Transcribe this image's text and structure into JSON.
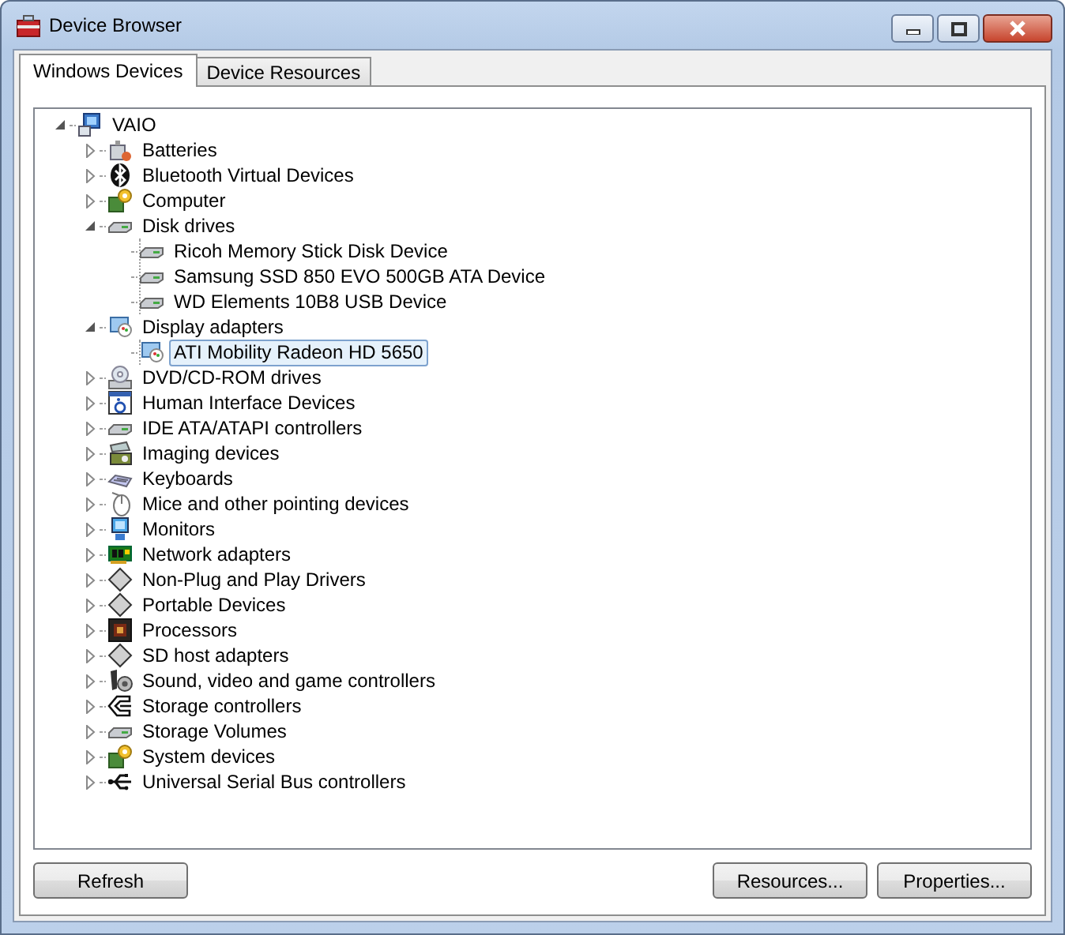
{
  "window": {
    "title": "Device Browser"
  },
  "tabs": [
    {
      "label": "Windows Devices",
      "selected": true
    },
    {
      "label": "Device Resources",
      "selected": false
    }
  ],
  "tree": [
    {
      "label": "VAIO",
      "kind": "computer",
      "expanded": true,
      "selected": false,
      "children": [
        {
          "label": "Batteries",
          "kind": "battery",
          "expanded": false,
          "selected": false
        },
        {
          "label": "Bluetooth Virtual Devices",
          "kind": "bluetooth",
          "expanded": false,
          "selected": false
        },
        {
          "label": "Computer",
          "kind": "system",
          "expanded": false,
          "selected": false
        },
        {
          "label": "Disk drives",
          "kind": "disk",
          "expanded": true,
          "selected": false,
          "children": [
            {
              "label": "Ricoh Memory Stick Disk Device",
              "kind": "disk",
              "selected": false
            },
            {
              "label": "Samsung SSD 850 EVO 500GB ATA Device",
              "kind": "disk",
              "selected": false
            },
            {
              "label": "WD Elements 10B8 USB Device",
              "kind": "disk",
              "selected": false
            }
          ]
        },
        {
          "label": "Display adapters",
          "kind": "display",
          "expanded": true,
          "selected": false,
          "children": [
            {
              "label": "ATI Mobility Radeon HD 5650",
              "kind": "display",
              "selected": true
            }
          ]
        },
        {
          "label": "DVD/CD-ROM drives",
          "kind": "dvd",
          "expanded": false,
          "selected": false
        },
        {
          "label": "Human Interface Devices",
          "kind": "hid",
          "expanded": false,
          "selected": false
        },
        {
          "label": "IDE ATA/ATAPI controllers",
          "kind": "disk",
          "expanded": false,
          "selected": false
        },
        {
          "label": "Imaging devices",
          "kind": "imaging",
          "expanded": false,
          "selected": false
        },
        {
          "label": "Keyboards",
          "kind": "keyboard",
          "expanded": false,
          "selected": false
        },
        {
          "label": "Mice and other pointing devices",
          "kind": "mouse",
          "expanded": false,
          "selected": false
        },
        {
          "label": "Monitors",
          "kind": "monitor",
          "expanded": false,
          "selected": false
        },
        {
          "label": "Network adapters",
          "kind": "network",
          "expanded": false,
          "selected": false
        },
        {
          "label": "Non-Plug and Play Drivers",
          "kind": "generic",
          "expanded": false,
          "selected": false
        },
        {
          "label": "Portable Devices",
          "kind": "generic",
          "expanded": false,
          "selected": false
        },
        {
          "label": "Processors",
          "kind": "processor",
          "expanded": false,
          "selected": false
        },
        {
          "label": "SD host adapters",
          "kind": "generic",
          "expanded": false,
          "selected": false
        },
        {
          "label": "Sound, video and game controllers",
          "kind": "sound",
          "expanded": false,
          "selected": false
        },
        {
          "label": "Storage controllers",
          "kind": "storage",
          "expanded": false,
          "selected": false
        },
        {
          "label": "Storage Volumes",
          "kind": "disk",
          "expanded": false,
          "selected": false
        },
        {
          "label": "System devices",
          "kind": "system",
          "expanded": false,
          "selected": false
        },
        {
          "label": "Universal Serial Bus controllers",
          "kind": "usb",
          "expanded": false,
          "selected": false
        }
      ]
    }
  ],
  "buttons_left": [
    "Refresh"
  ],
  "buttons_right": [
    "Resources...",
    "Properties..."
  ]
}
